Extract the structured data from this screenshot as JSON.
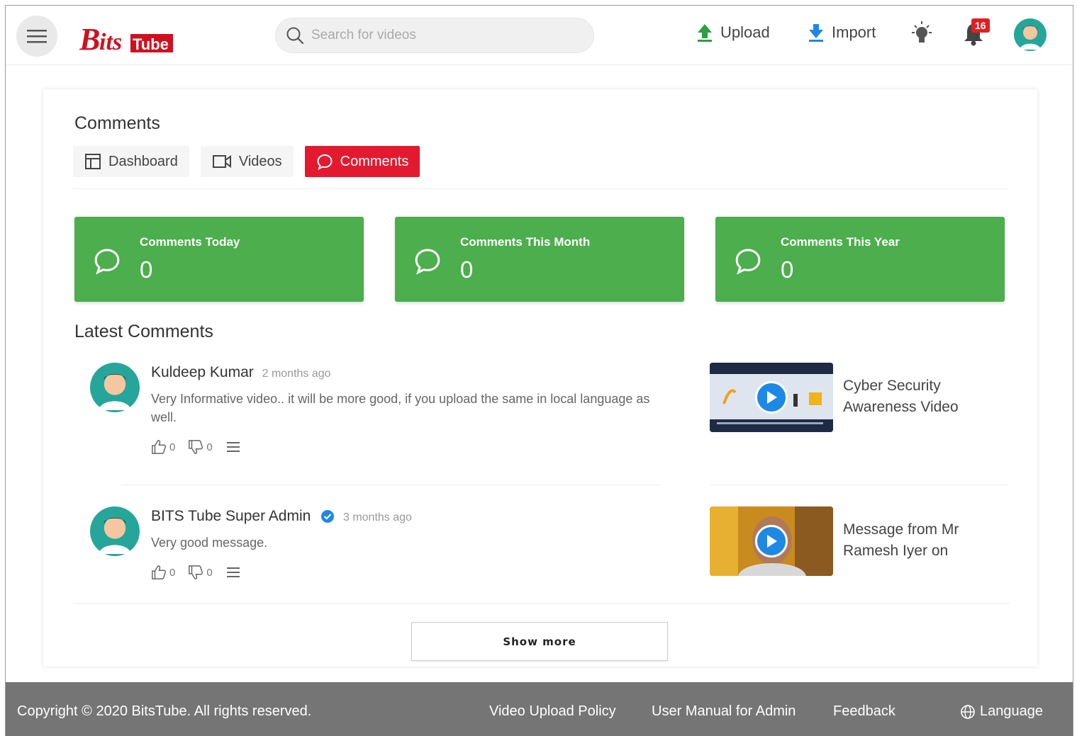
{
  "header": {
    "logo_text": "BitsTube",
    "search_placeholder": "Search for videos",
    "upload_label": "Upload",
    "import_label": "Import",
    "notification_count": "16"
  },
  "page": {
    "title": "Comments",
    "tabs": [
      {
        "label": "Dashboard",
        "active": false
      },
      {
        "label": "Videos",
        "active": false
      },
      {
        "label": "Comments",
        "active": true
      }
    ]
  },
  "stats": [
    {
      "label": "Comments Today",
      "value": "0"
    },
    {
      "label": "Comments This Month",
      "value": "0"
    },
    {
      "label": "Comments This Year",
      "value": "0"
    }
  ],
  "latest": {
    "title": "Latest Comments",
    "comments": [
      {
        "author": "Kuldeep Kumar",
        "time": "2 months ago",
        "text": "Very Informative video.. it will be more good, if you upload the same in local language as well.",
        "likes": "0",
        "dislikes": "0",
        "video_title": "Cyber Security Awareness Video"
      },
      {
        "author": "BITS Tube Super Admin",
        "time": "3 months ago",
        "text": "Very good message.",
        "likes": "0",
        "dislikes": "0",
        "video_title": "Message from Mr Ramesh Iyer on"
      }
    ],
    "show_more": "Show more"
  },
  "footer": {
    "copyright": "Copyright © 2020 BitsTube. All rights reserved.",
    "links": [
      "Video Upload Policy",
      "User Manual for Admin",
      "Feedback"
    ],
    "language": "Language"
  },
  "colors": {
    "accent_red": "#e3192f",
    "stat_green": "#4cae4c",
    "play_blue": "#1e88e5",
    "footer_gray": "#757575"
  }
}
